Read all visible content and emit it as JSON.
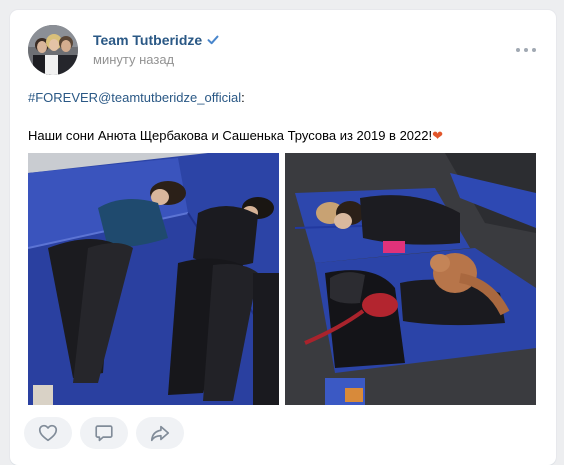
{
  "post": {
    "author": "Team Tutberidze",
    "verified_icon": "verified-check-icon",
    "time": "минуту назад",
    "hashtag": "#FOREVER",
    "mention": "@teamtutberidze_official",
    "mention_suffix": ":",
    "body": "Наши сони Анюта Щербакова и Сашенька Трусова из 2019 в 2022!",
    "emoji": "❤"
  },
  "actions": {
    "like_icon": "heart-icon",
    "comment_icon": "comment-icon",
    "share_icon": "share-icon"
  },
  "colors": {
    "link": "#2a5885",
    "accent": "#4986cc",
    "mat_blue": "#2d46a8"
  }
}
